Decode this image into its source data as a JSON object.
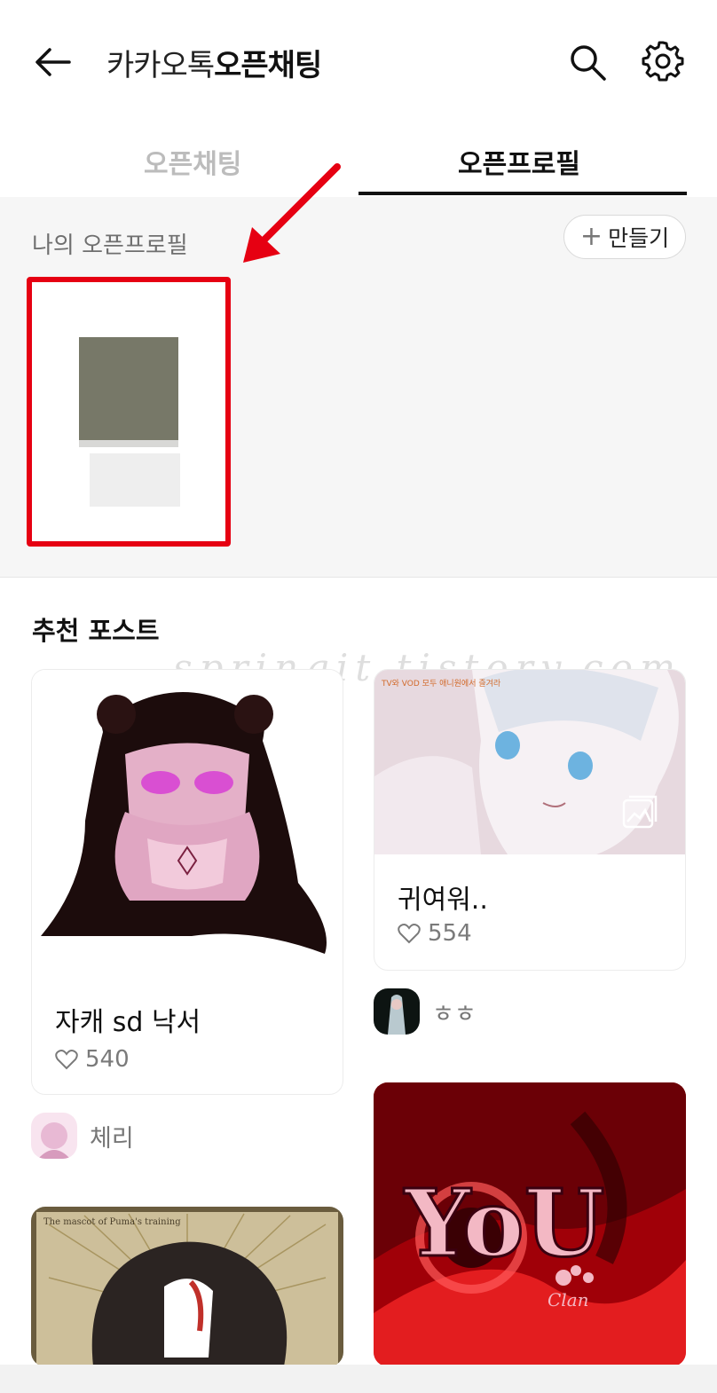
{
  "header": {
    "title_prefix": "카카오톡",
    "title_suffix": "오픈채팅"
  },
  "tabs": [
    {
      "label": "오픈채팅",
      "active": false
    },
    {
      "label": "오픈프로필",
      "active": true
    }
  ],
  "my_profile": {
    "section_label": "나의 오픈프로필",
    "create_button_label": "만들기"
  },
  "recommended": {
    "section_title": "추천 포스트",
    "posts": [
      {
        "title": "자캐 sd 낙서",
        "likes": "540",
        "author": "체리"
      },
      {
        "title": "귀여워..",
        "likes": "554",
        "author": "ㅎㅎ"
      }
    ],
    "banner_text": "YoU",
    "banner_subtext": "Clan",
    "card3_caption": "The mascot of Puma's training",
    "card2_overlay": "TV와 VOD 모두 애니원에서 즐겨라"
  },
  "watermark": "springit.tistory.com",
  "colors": {
    "accent_red": "#e60012",
    "tab_active": "#111111",
    "tab_inactive": "#bcbcbc"
  }
}
